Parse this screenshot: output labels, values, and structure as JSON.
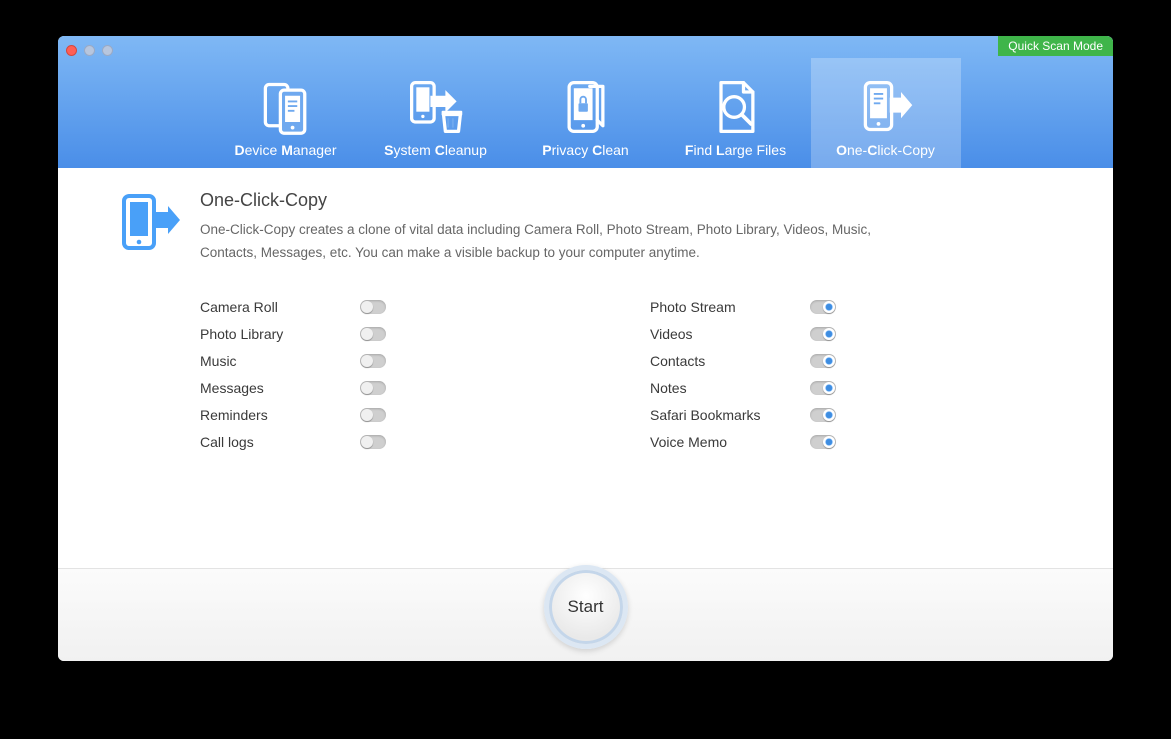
{
  "window": {
    "quick_scan_label": "Quick Scan Mode"
  },
  "tabs": [
    {
      "id": "device-manager",
      "label_parts": [
        "D",
        "evice ",
        "M",
        "anager"
      ]
    },
    {
      "id": "system-cleanup",
      "label_parts": [
        "S",
        "ystem ",
        "C",
        "leanup"
      ]
    },
    {
      "id": "privacy-clean",
      "label_parts": [
        "P",
        "rivacy ",
        "C",
        "lean"
      ]
    },
    {
      "id": "find-large-files",
      "label_parts": [
        "F",
        "ind ",
        "L",
        "arge Files"
      ]
    },
    {
      "id": "one-click-copy",
      "label_parts": [
        "O",
        "ne-",
        "C",
        "lick-Copy"
      ],
      "active": true
    }
  ],
  "intro": {
    "title": "One-Click-Copy",
    "description": "One-Click-Copy creates a clone of vital data including Camera Roll, Photo Stream, Photo Library, Videos, Music, Contacts, Messages, etc. You can make a visible backup to your computer anytime."
  },
  "options": {
    "left": [
      {
        "id": "camera-roll",
        "label": "Camera Roll",
        "on": false
      },
      {
        "id": "photo-library",
        "label": "Photo Library",
        "on": false
      },
      {
        "id": "music",
        "label": "Music",
        "on": false
      },
      {
        "id": "messages",
        "label": "Messages",
        "on": false
      },
      {
        "id": "reminders",
        "label": "Reminders",
        "on": false
      },
      {
        "id": "call-logs",
        "label": "Call logs",
        "on": false
      }
    ],
    "right": [
      {
        "id": "photo-stream",
        "label": "Photo Stream",
        "on": true
      },
      {
        "id": "videos",
        "label": "Videos",
        "on": true
      },
      {
        "id": "contacts",
        "label": "Contacts",
        "on": true
      },
      {
        "id": "notes",
        "label": "Notes",
        "on": true
      },
      {
        "id": "safari-bookmarks",
        "label": "Safari Bookmarks",
        "on": true
      },
      {
        "id": "voice-memo",
        "label": "Voice Memo",
        "on": true
      }
    ]
  },
  "footer": {
    "start_label": "Start"
  }
}
